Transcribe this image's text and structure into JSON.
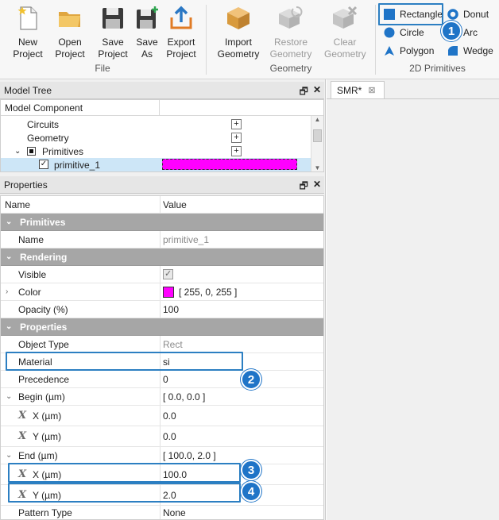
{
  "ribbon": {
    "file_group": {
      "label": "File",
      "buttons": [
        {
          "label": "New\nProject",
          "icon": "new-project-icon"
        },
        {
          "label": "Open\nProject",
          "icon": "open-folder-icon"
        },
        {
          "label": "Save\nProject",
          "icon": "save-disk-icon"
        },
        {
          "label": "Save\nAs",
          "icon": "save-as-icon"
        },
        {
          "label": "Export\nProject",
          "icon": "export-icon"
        }
      ]
    },
    "geometry_group": {
      "label": "Geometry",
      "buttons": [
        {
          "label": "Import\nGeometry",
          "icon": "import-geometry-icon"
        },
        {
          "label": "Restore\nGeometry",
          "icon": "restore-geometry-icon"
        },
        {
          "label": "Clear\nGeometry",
          "icon": "clear-geometry-icon"
        }
      ]
    },
    "primitives_group": {
      "label": "2D Primitives",
      "items": [
        "Rectangle",
        "Donut",
        "Circle",
        "Arc",
        "Polygon",
        "Wedge"
      ]
    }
  },
  "callouts": [
    "1",
    "2",
    "3",
    "4"
  ],
  "model_tree": {
    "title": "Model Tree",
    "header": "Model Component",
    "rows": [
      "Circuits",
      "Geometry",
      "Primitives",
      "primitive_1"
    ],
    "plus": "+",
    "primitive_color": "#ff00ff"
  },
  "properties": {
    "title": "Properties",
    "col_name": "Name",
    "col_value": "Value",
    "categories": {
      "primitives": "Primitives",
      "rendering": "Rendering",
      "properties": "Properties"
    },
    "rows": {
      "name": {
        "label": "Name",
        "value": "primitive_1"
      },
      "visible": {
        "label": "Visible",
        "checked": true
      },
      "color": {
        "label": "Color",
        "value": "[ 255, 0, 255 ]",
        "swatch": "#ff00ff"
      },
      "opacity": {
        "label": "Opacity (%)",
        "value": "100"
      },
      "object_type": {
        "label": "Object Type",
        "value": "Rect"
      },
      "material": {
        "label": "Material",
        "value": "si"
      },
      "precedence": {
        "label": "Precedence",
        "value": "0"
      },
      "begin": {
        "label": "Begin (µm)",
        "value": "[ 0.0, 0.0 ]"
      },
      "begin_x": {
        "label": "X (µm)",
        "value": "0.0"
      },
      "begin_y": {
        "label": "Y (µm)",
        "value": "0.0"
      },
      "end": {
        "label": "End (µm)",
        "value": "[ 100.0, 2.0 ]"
      },
      "end_x": {
        "label": "X (µm)",
        "value": "100.0"
      },
      "end_y": {
        "label": "Y (µm)",
        "value": "2.0"
      },
      "pattern_type": {
        "label": "Pattern Type",
        "value": "None"
      }
    }
  },
  "editor": {
    "tab_label": "SMR*",
    "close_glyph": "⊠"
  },
  "colors": {
    "accent": "#1f74c7",
    "highlight": "#2c7fc2",
    "category_bg": "#a6a6a6",
    "magenta": "#ff00ff"
  }
}
